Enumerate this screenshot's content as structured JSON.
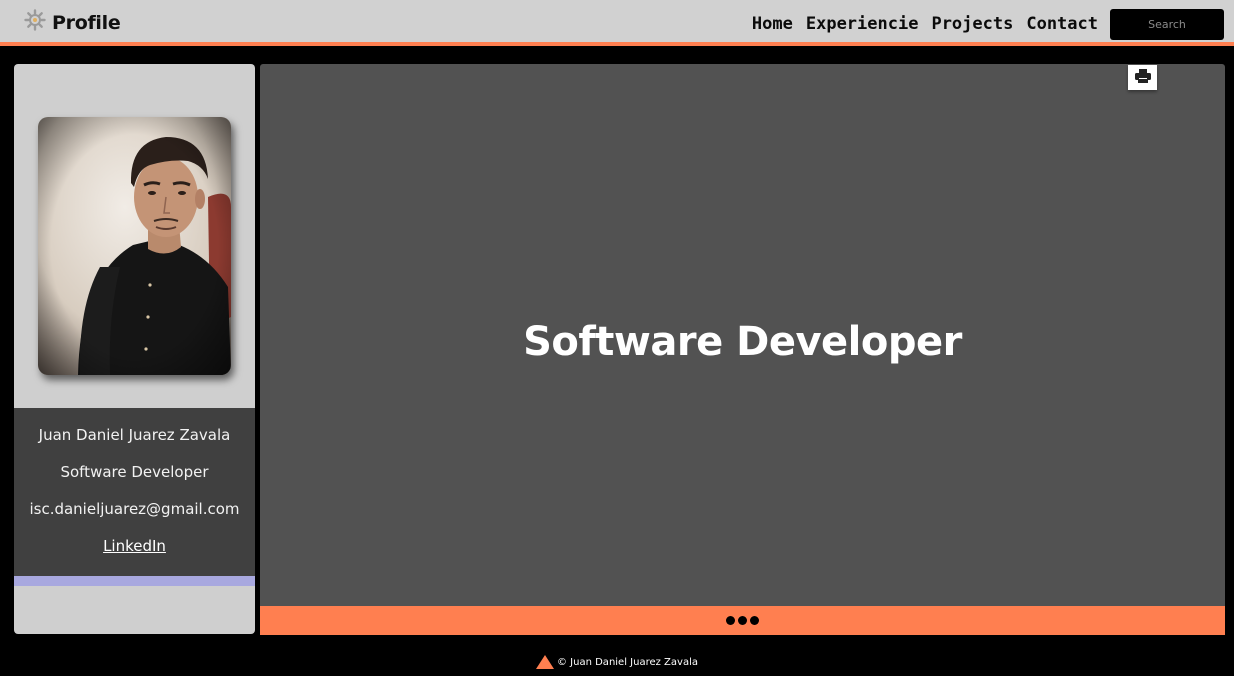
{
  "header": {
    "brand_icon": "gear-icon",
    "brand_title": "Profile",
    "nav": [
      {
        "label": "Home"
      },
      {
        "label": "Experiencie"
      },
      {
        "label": "Projects"
      },
      {
        "label": "Contact"
      }
    ],
    "search": {
      "placeholder": "Search",
      "value": ""
    }
  },
  "profile": {
    "photo": "profile-photo",
    "name": "Juan Daniel Juarez Zavala",
    "role": "Software Developer",
    "email": "isc.danieljuarez@gmail.com",
    "link": "LinkedIn"
  },
  "main": {
    "title": "Software Developer",
    "print_icon": "printer-icon",
    "dots": [
      "dot",
      "dot",
      "dot"
    ]
  },
  "footer": {
    "icon": "triangle-icon",
    "copyright": "© Juan Daniel Juarez Zavala"
  },
  "colors": {
    "accent": "#ff7f50",
    "header_bg": "#d1d1d1",
    "panel_bg": "#525252",
    "info_bg": "#404040",
    "stripe": "#a8a8df"
  }
}
